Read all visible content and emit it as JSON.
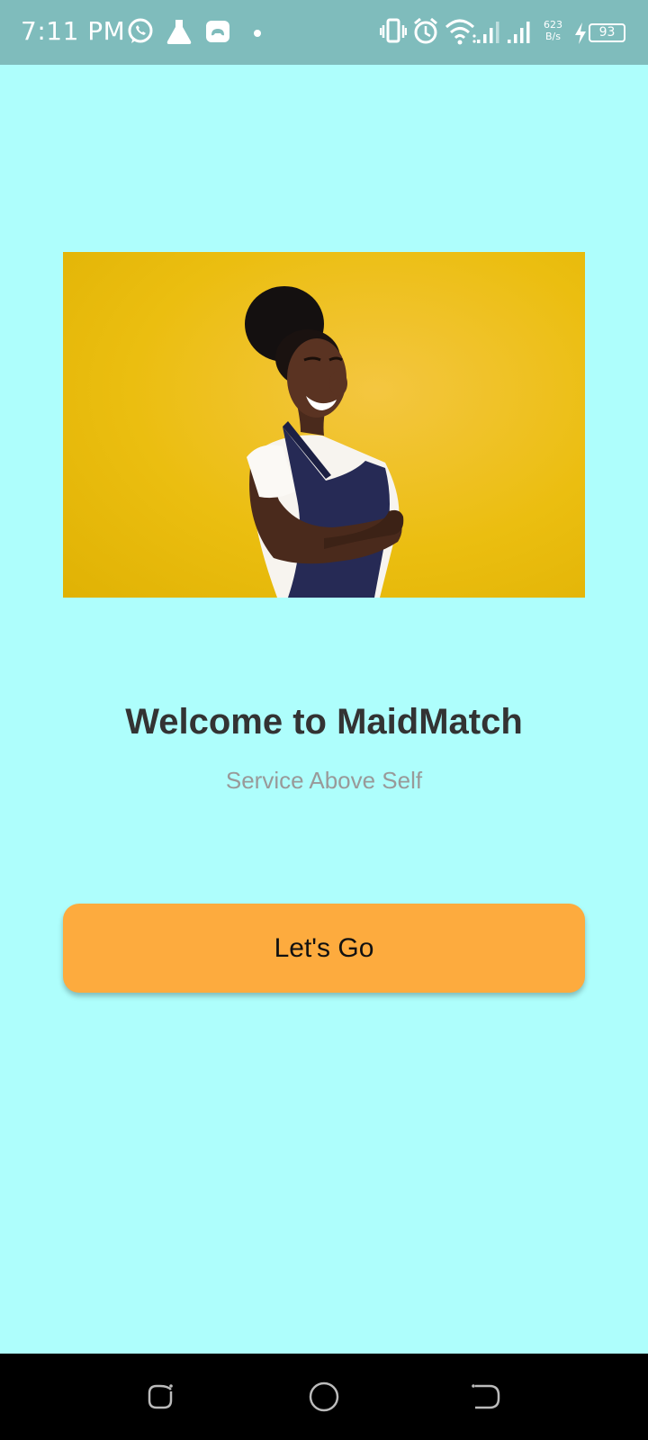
{
  "status_bar": {
    "time": "7:11 PM",
    "net_speed_value": "623",
    "net_speed_unit": "B/s",
    "battery": "93",
    "icons": [
      "whatsapp-icon",
      "flask-icon",
      "game-controller-icon",
      "dot-icon",
      "vibrate-icon",
      "alarm-icon",
      "wifi-icon",
      "signal-icon",
      "signal-icon",
      "charging-icon",
      "battery-icon"
    ]
  },
  "main": {
    "hero_image": "woman-in-apron-photo",
    "title": "Welcome to MaidMatch",
    "tagline": "Service Above Self",
    "button_label": "Let's Go"
  },
  "nav_bar": {
    "buttons": [
      "recents-button",
      "home-button",
      "back-button"
    ]
  },
  "colors": {
    "background": "#aefefc",
    "status_bar": "#7fbcbc",
    "button": "#fdab3e",
    "title": "#333333",
    "tagline": "#999999",
    "hero_background": "#ebbe10"
  }
}
